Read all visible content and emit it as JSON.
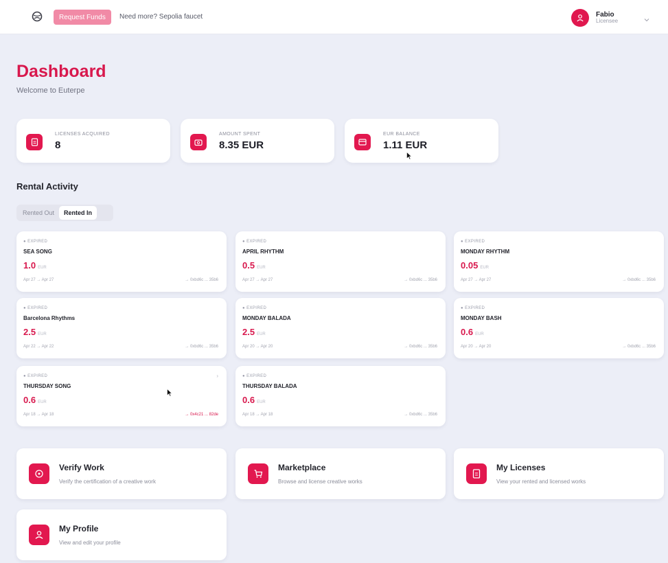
{
  "topbar": {
    "logo_icon": "globe-icon",
    "request_funds_label": "Request Funds",
    "faucet_text": "Need more? Sepolia faucet",
    "user": {
      "name": "Fabio",
      "role": "Licensee",
      "avatar_icon": "user-icon"
    }
  },
  "header": {
    "title": "Dashboard",
    "subtitle": "Welcome to Euterpe"
  },
  "stats": [
    {
      "label": "LICENSES ACQUIRED",
      "value": "8",
      "icon": "document-icon"
    },
    {
      "label": "AMOUNT SPENT",
      "value": "8.35 EUR",
      "icon": "wallet-icon"
    },
    {
      "label": "EUR BALANCE",
      "value": "1.11 EUR",
      "icon": "card-icon"
    }
  ],
  "rental": {
    "title": "Rental Activity",
    "tabs": [
      {
        "label": "Rented Out",
        "active": false
      },
      {
        "label": "Rented In",
        "active": true
      }
    ],
    "cards": [
      {
        "status": "● EXPIRED",
        "name": "SEA SONG",
        "price": "1.0",
        "currency": "EUR",
        "dates": "Apr 27 → Apr 27",
        "address": "→ 0xbd6c ... 35b6"
      },
      {
        "status": "● EXPIRED",
        "name": "APRIL RHYTHM",
        "price": "0.5",
        "currency": "EUR",
        "dates": "Apr 27 → Apr 27",
        "address": "→ 0xbd6c ... 35b6"
      },
      {
        "status": "● EXPIRED",
        "name": "MONDAY RHYTHM",
        "price": "0.05",
        "currency": "EUR",
        "dates": "Apr 27 → Apr 27",
        "address": "→ 0xbd6c ... 35b6"
      },
      {
        "status": "● EXPIRED",
        "name": "Barcelona Rhythms",
        "price": "2.5",
        "currency": "EUR",
        "dates": "Apr 22 → Apr 22",
        "address": "→ 0xbd6c ... 35b6"
      },
      {
        "status": "● EXPIRED",
        "name": "MONDAY BALADA",
        "price": "2.5",
        "currency": "EUR",
        "dates": "Apr 20 → Apr 20",
        "address": "→ 0xbd6c ... 35b6"
      },
      {
        "status": "● EXPIRED",
        "name": "MONDAY BASH",
        "price": "0.6",
        "currency": "EUR",
        "dates": "Apr 20 → Apr 20",
        "address": "→ 0xbd6c ... 35b6"
      },
      {
        "status": "● EXPIRED",
        "name": "THURSDAY SONG",
        "price": "0.6",
        "currency": "EUR",
        "dates": "Apr 18 → Apr 18",
        "address": "→ 0x4c21 ... 82de"
      },
      {
        "status": "● EXPIRED",
        "name": "THURSDAY BALADA",
        "price": "0.6",
        "currency": "EUR",
        "dates": "Apr 18 → Apr 18",
        "address": "→ 0xbd6c ... 35b6"
      }
    ]
  },
  "quick_links": [
    {
      "title": "Verify Work",
      "desc": "Verify the certification of a creative work",
      "icon": "target-icon"
    },
    {
      "title": "Marketplace",
      "desc": "Browse and license creative works",
      "icon": "cart-icon"
    },
    {
      "title": "My Licenses",
      "desc": "View your rented and licensed works",
      "icon": "document-icon"
    },
    {
      "title": "My Profile",
      "desc": "View and edit your profile",
      "icon": "user-icon"
    }
  ],
  "colors": {
    "accent": "#d8184d",
    "request_button": "#f18aa6",
    "background": "#eceef7"
  }
}
